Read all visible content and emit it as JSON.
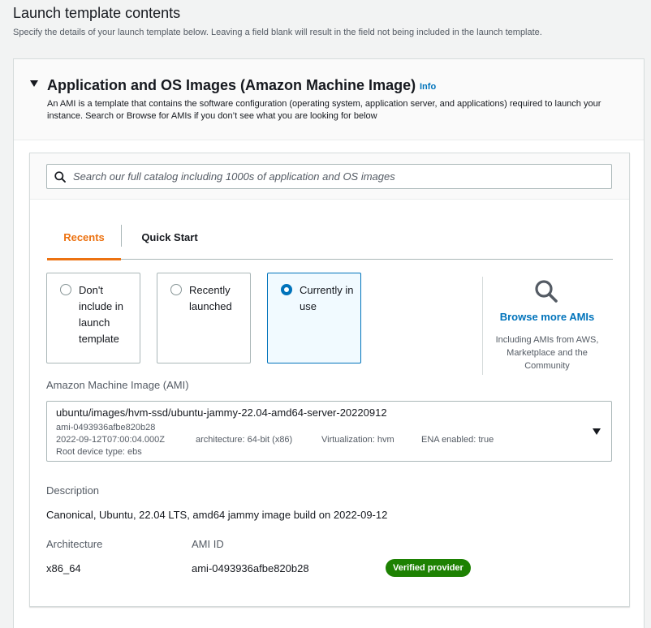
{
  "page": {
    "title": "Launch template contents",
    "subtitle": "Specify the details of your launch template below. Leaving a field blank will result in the field not being included in the launch template."
  },
  "section": {
    "title": "Application and OS Images (Amazon Machine Image)",
    "info_label": "Info",
    "description": "An AMI is a template that contains the software configuration (operating system, application server, and applications) required to launch your instance. Search or Browse for AMIs if you don’t see what you are looking for below"
  },
  "search": {
    "placeholder": "Search our full catalog including 1000s of application and OS images",
    "value": ""
  },
  "tabs": [
    {
      "label": "Recents",
      "active": true
    },
    {
      "label": "Quick Start",
      "active": false
    }
  ],
  "options": [
    {
      "label": "Don't include in launch template",
      "selected": false
    },
    {
      "label": "Recently launched",
      "selected": false
    },
    {
      "label": "Currently in use",
      "selected": true
    }
  ],
  "browse": {
    "link_label": "Browse more AMIs",
    "note": "Including AMIs from AWS, Marketplace and the Community"
  },
  "ami": {
    "field_label": "Amazon Machine Image (AMI)",
    "name": "ubuntu/images/hvm-ssd/ubuntu-jammy-22.04-amd64-server-20220912",
    "id": "ami-0493936afbe820b28",
    "date": "2022-09-12T07:00:04.000Z",
    "architecture": "architecture: 64-bit (x86)",
    "virtualization": "Virtualization: hvm",
    "ena": "ENA enabled: true",
    "root_device": "Root device type: ebs"
  },
  "details": {
    "description_label": "Description",
    "description_value": "Canonical, Ubuntu, 22.04 LTS, amd64 jammy image build on 2022-09-12",
    "architecture_label": "Architecture",
    "architecture_value": "x86_64",
    "ami_id_label": "AMI ID",
    "ami_id_value": "ami-0493936afbe820b28",
    "badge": "Verified provider"
  },
  "colors": {
    "accent_orange": "#ec7211",
    "link_blue": "#0073bb",
    "badge_green": "#1d8102"
  }
}
